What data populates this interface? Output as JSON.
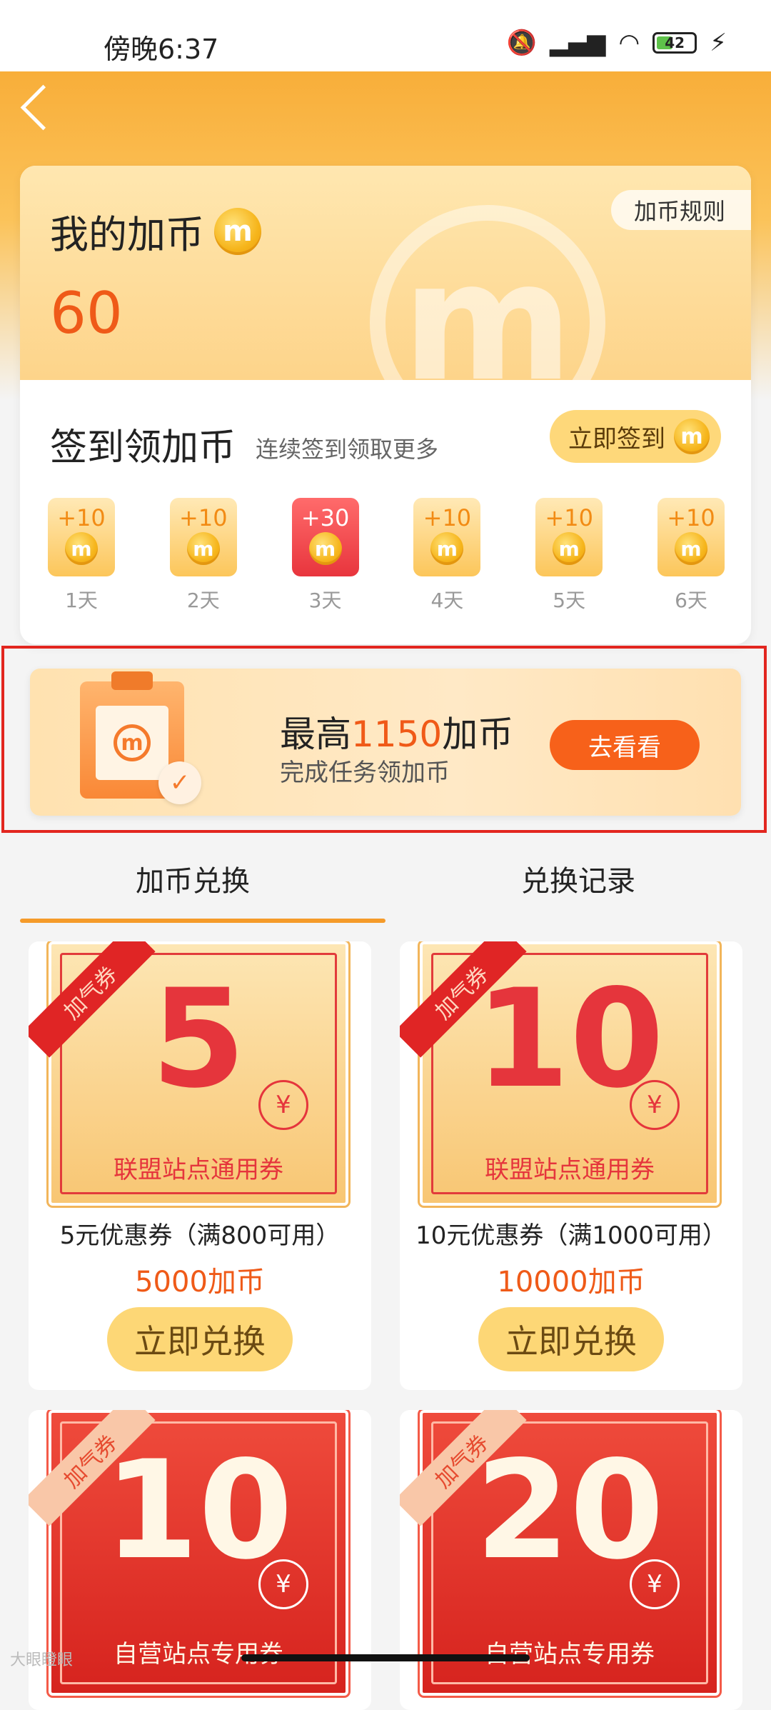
{
  "status": {
    "time": "傍晚6:37",
    "battery": "42"
  },
  "account": {
    "title": "我的加币",
    "balance": "60",
    "rules_label": "加币规则"
  },
  "checkin": {
    "title": "签到领加币",
    "subtitle": "连续签到领取更多",
    "button_label": "立即签到",
    "days": [
      {
        "bonus": "+10",
        "label": "1天"
      },
      {
        "bonus": "+10",
        "label": "2天"
      },
      {
        "bonus": "+30",
        "label": "3天"
      },
      {
        "bonus": "+10",
        "label": "4天"
      },
      {
        "bonus": "+10",
        "label": "5天"
      },
      {
        "bonus": "+10",
        "label": "6天"
      }
    ]
  },
  "task": {
    "headline_prefix": "最高",
    "headline_number": "1150",
    "headline_suffix": "加币",
    "subtitle": "完成任务领加币",
    "button_label": "去看看"
  },
  "tabs": [
    {
      "label": "加币兑换"
    },
    {
      "label": "兑换记录"
    }
  ],
  "coupons": [
    {
      "ribbon": "加气券",
      "value": "5",
      "yen": "¥",
      "desc": "联盟站点通用券",
      "name": "5元优惠券（满800可用）",
      "price": "5000加币",
      "redeem_label": "立即兑换"
    },
    {
      "ribbon": "加气券",
      "value": "10",
      "yen": "¥",
      "desc": "联盟站点通用券",
      "name": "10元优惠券（满1000可用）",
      "price": "10000加币",
      "redeem_label": "立即兑换"
    },
    {
      "ribbon": "加气券",
      "value": "10",
      "yen": "¥",
      "desc": "自营站点专用券"
    },
    {
      "ribbon": "加气券",
      "value": "20",
      "yen": "¥",
      "desc": "自营站点专用券"
    }
  ],
  "watermark": "大眼瞪眼",
  "colors": {
    "accent": "#f7611a",
    "gold": "#fdd776",
    "highlight_frame": "#e2261f"
  }
}
